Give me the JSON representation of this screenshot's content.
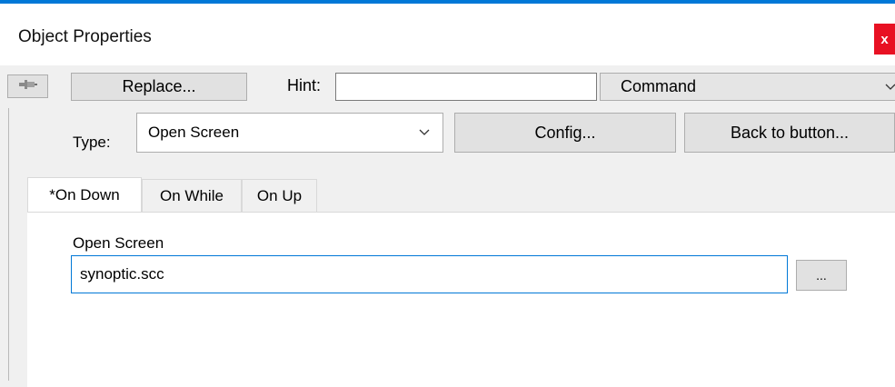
{
  "colors": {
    "accent": "#0078d7",
    "close": "#e81123",
    "panel": "#f0f0f0"
  },
  "window": {
    "title": "Object Properties",
    "close_glyph": "x"
  },
  "toolbar": {
    "pin_icon": "pushpin-icon",
    "replace_label": "Replace...",
    "hint_label": "Hint:",
    "hint_value": "",
    "command_value": "Command"
  },
  "type_row": {
    "type_label": "Type:",
    "type_value": "Open Screen",
    "config_label": "Config...",
    "back_label": "Back to button..."
  },
  "tabs": [
    {
      "label": "*On Down",
      "active": true
    },
    {
      "label": "On While",
      "active": false
    },
    {
      "label": "On Up",
      "active": false
    }
  ],
  "open_screen": {
    "label": "Open Screen",
    "value": "synoptic.scc",
    "browse_label": "..."
  }
}
